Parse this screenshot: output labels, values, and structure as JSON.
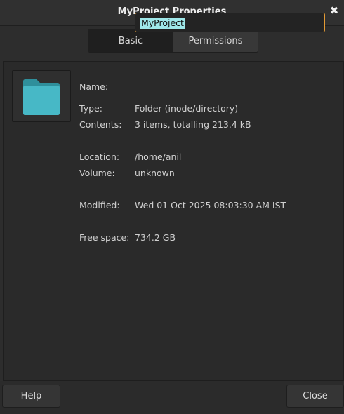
{
  "window": {
    "title": "MyProject Properties",
    "close_glyph": "✖"
  },
  "tabs": [
    {
      "label": "Basic",
      "active": true
    },
    {
      "label": "Permissions",
      "active": false
    }
  ],
  "icon": {
    "name": "folder-icon",
    "color": "#47b8c6"
  },
  "properties": {
    "name": {
      "label": "Name:",
      "value": "MyProject"
    },
    "type": {
      "label": "Type:",
      "value": "Folder (inode/directory)"
    },
    "contents": {
      "label": "Contents:",
      "value": "3 items, totalling 213.4 kB"
    },
    "location": {
      "label": "Location:",
      "value": "/home/anil"
    },
    "volume": {
      "label": "Volume:",
      "value": "unknown"
    },
    "modified": {
      "label": "Modified:",
      "value": "Wed 01 Oct 2025 08:03:30 AM IST"
    },
    "free_space": {
      "label": "Free space:",
      "value": "734.2 GB"
    }
  },
  "buttons": {
    "help": "Help",
    "close": "Close"
  },
  "colors": {
    "focus_border": "#e29a34",
    "selection": "#9fe8ea"
  }
}
